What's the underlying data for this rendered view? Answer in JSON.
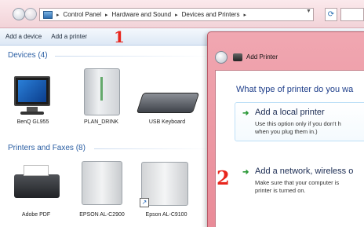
{
  "explorer": {
    "breadcrumb": [
      "Control Panel",
      "Hardware and Sound",
      "Devices and Printers"
    ],
    "toolbar": {
      "add_device": "Add a device",
      "add_printer": "Add a printer"
    },
    "annotation_1": "1",
    "groups": {
      "devices": "Devices (4)",
      "printers": "Printers and Faxes (8)"
    },
    "devices": [
      "BenQ GL955",
      "PLAN_DRINK",
      "USB Keyboard"
    ],
    "printers": [
      "Adobe PDF",
      "EPSON AL-C2900",
      "Epson AL-C9100"
    ]
  },
  "dialog": {
    "title": "Add Printer",
    "heading": "What type of printer do you wa",
    "option_local": {
      "title": "Add a local printer",
      "desc_line1": "Use this option only if you don't h",
      "desc_line2": "when you plug them in.)"
    },
    "option_network": {
      "title": "Add a network, wireless o",
      "desc_line1": "Make sure that your computer is",
      "desc_line2": "printer is turned on."
    },
    "annotation_2": "2"
  },
  "colors": {
    "annotation": "#e8251c",
    "dialog_frame": "#e98a97",
    "link_heading": "#1e3e8a",
    "arrow": "#2e9a3a"
  },
  "icons": [
    "back-icon",
    "forward-icon",
    "control-panel-icon",
    "refresh-icon",
    "monitor-icon",
    "computer-icon",
    "keyboard-icon",
    "printer-icon",
    "green-arrow-icon"
  ]
}
